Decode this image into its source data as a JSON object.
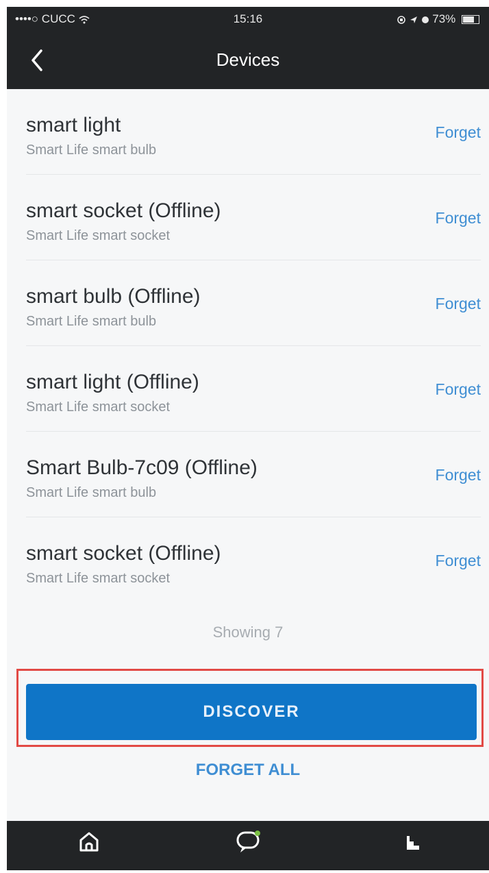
{
  "status_bar": {
    "carrier": "••••○ CUCC",
    "time": "15:16",
    "battery": "73%"
  },
  "header": {
    "title": "Devices",
    "back_icon": "chevron-left-icon"
  },
  "devices": [
    {
      "name": "smart light",
      "type": "Smart Life smart bulb",
      "action": "Forget"
    },
    {
      "name": "smart socket (Offline)",
      "type": "Smart Life smart socket",
      "action": "Forget"
    },
    {
      "name": "smart bulb (Offline)",
      "type": "Smart Life smart bulb",
      "action": "Forget"
    },
    {
      "name": "smart light (Offline)",
      "type": "Smart Life smart socket",
      "action": "Forget"
    },
    {
      "name": "Smart Bulb-7c09 (Offline)",
      "type": "Smart Life smart bulb",
      "action": "Forget"
    },
    {
      "name": "smart socket (Offline)",
      "type": "Smart Life smart socket",
      "action": "Forget"
    }
  ],
  "showing_text": "Showing 7",
  "buttons": {
    "discover": "DISCOVER",
    "forget_all": "FORGET ALL"
  },
  "tabs": [
    {
      "icon": "home-icon"
    },
    {
      "icon": "chat-bubble-icon"
    },
    {
      "icon": "bar-chart-icon"
    }
  ],
  "colors": {
    "accent": "#0f75c7",
    "link": "#3f8ed3",
    "highlight": "#e24a45",
    "nav_background": "#222426"
  }
}
